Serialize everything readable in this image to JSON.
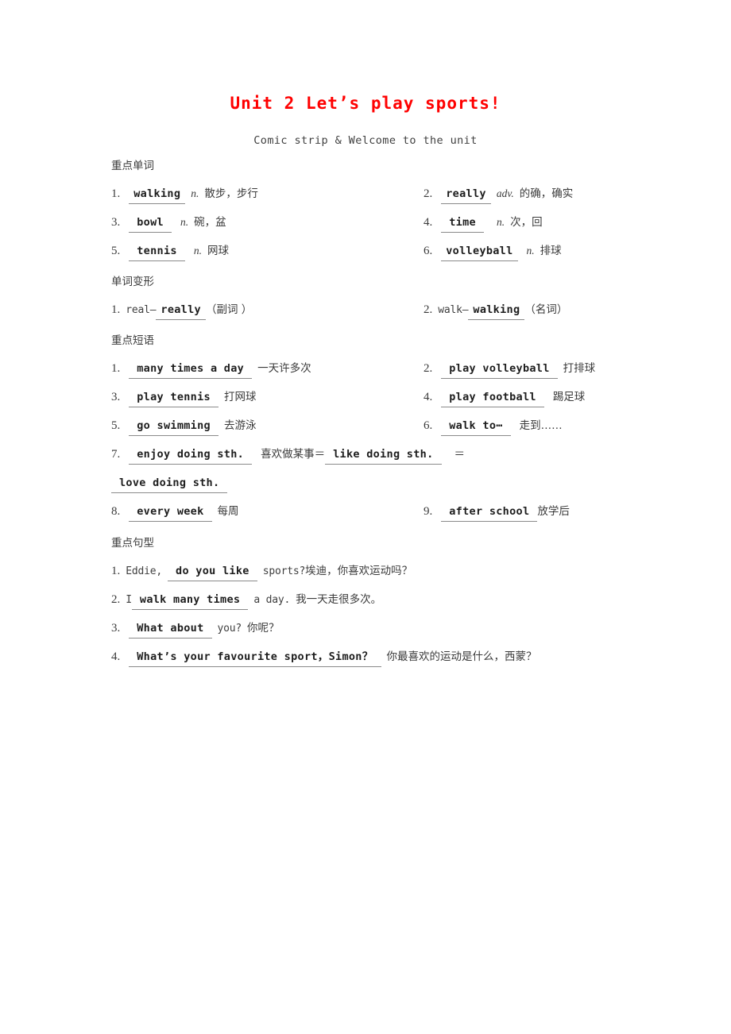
{
  "document": {
    "title": "Unit 2  Let’s play sports!",
    "subtitle": "Comic strip & Welcome to the unit",
    "title_color": "#ff0000"
  },
  "sections": {
    "words": {
      "heading": "重点单词",
      "items": [
        {
          "num": "1.",
          "answer": "walking",
          "pos": "n.",
          "gloss": "散步，步行"
        },
        {
          "num": "2.",
          "answer": "really",
          "pos": "adv.",
          "gloss": "的确，确实"
        },
        {
          "num": "3.",
          "answer": "bowl",
          "pos": "n.",
          "gloss": "碗，盆"
        },
        {
          "num": "4.",
          "answer": "time",
          "pos": "n.",
          "gloss": "次，回"
        },
        {
          "num": "5.",
          "answer": "tennis",
          "pos": "n.",
          "gloss": "网球"
        },
        {
          "num": "6.",
          "answer": "volleyball",
          "pos": "n.",
          "gloss": "排球"
        }
      ]
    },
    "word_forms": {
      "heading": "单词变形",
      "items": [
        {
          "num": "1.",
          "base": "real—",
          "answer": "really",
          "note": "（副词 ）"
        },
        {
          "num": "2.",
          "base": "walk—",
          "answer": "walking",
          "note": "（名词）"
        }
      ]
    },
    "phrases": {
      "heading": "重点短语",
      "items": [
        {
          "num": "1.",
          "answer": "many times a day",
          "gloss": "一天许多次"
        },
        {
          "num": "2.",
          "answer": "play volleyball",
          "gloss": "打排球"
        },
        {
          "num": "3.",
          "answer": "play tennis",
          "gloss": "打网球"
        },
        {
          "num": "4.",
          "answer": "play football",
          "gloss": "踢足球"
        },
        {
          "num": "5.",
          "answer": "go swimming",
          "gloss": "去游泳"
        },
        {
          "num": "6.",
          "answer": "walk to⋯",
          "gloss": "走到……"
        },
        {
          "num": "8.",
          "answer": "every week",
          "gloss": "每周"
        },
        {
          "num": "9.",
          "answer": "after school",
          "gloss": "放学后"
        }
      ],
      "item7": {
        "num": "7.",
        "answer1": "enjoy doing sth.",
        "gloss": "喜欢做某事",
        "eq1": "＝",
        "answer2": "like doing sth.",
        "eq2": "＝",
        "answer3": "love doing sth."
      }
    },
    "sentences": {
      "heading": "重点句型",
      "items": [
        {
          "num": "1.",
          "before": "Eddie,",
          "answer": "do you like",
          "after": "sports?",
          "gloss": "埃迪，你喜欢运动吗？"
        },
        {
          "num": "2.",
          "before": "I",
          "answer": "walk many times",
          "after": "a day.",
          "gloss": "我一天走很多次。"
        },
        {
          "num": "3.",
          "before": "",
          "answer": "What about",
          "after": "you?",
          "gloss": "你呢？"
        },
        {
          "num": "4.",
          "before": "",
          "answer": "What’s your favourite sport，Simon？",
          "after": "",
          "gloss": "你最喜欢的运动是什么，西蒙？"
        }
      ]
    }
  }
}
